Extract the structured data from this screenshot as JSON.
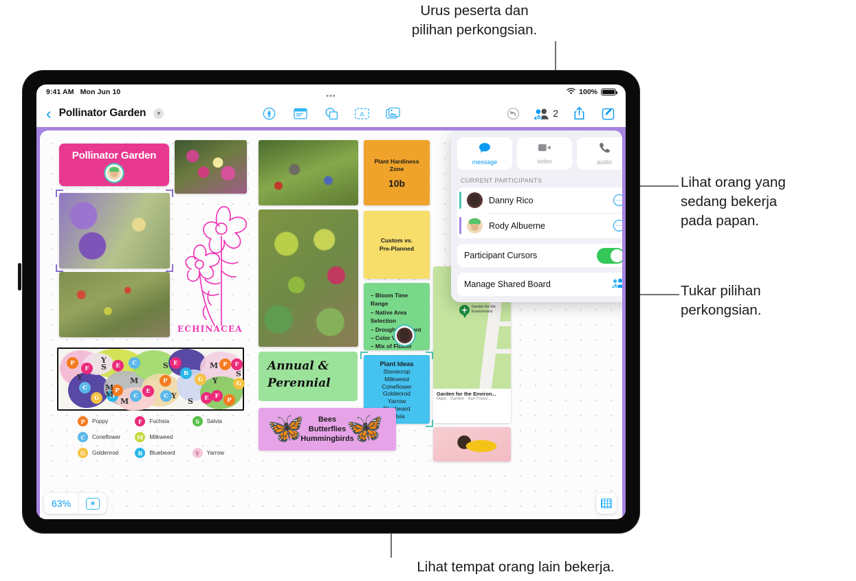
{
  "callouts": {
    "top": "Urus peserta dan\npilihan perkongsian.",
    "right_upper": "Lihat orang yang\nsedang bekerja\npada papan.",
    "right_lower": "Tukar pilihan\nperkongsian.",
    "bottom": "Lihat tempat orang lain bekerja."
  },
  "status_bar": {
    "time": "9:41 AM",
    "date": "Mon Jun 10",
    "wifi_icon": "wifi-icon",
    "battery_percent": "100%",
    "battery_icon": "battery-icon"
  },
  "toolbar": {
    "back_icon": "chevron-left-icon",
    "title": "Pollinator Garden",
    "title_chevron_icon": "chevron-down-icon",
    "overflow_icon": "ellipsis-icon",
    "center_tools": [
      {
        "name": "pen-tool-icon",
        "label": "Pen"
      },
      {
        "name": "sticky-note-icon",
        "label": "Sticky Note"
      },
      {
        "name": "shapes-icon",
        "label": "Shapes"
      },
      {
        "name": "text-box-icon",
        "label": "Text Box"
      },
      {
        "name": "media-icon",
        "label": "Media"
      }
    ],
    "right_tools": [
      {
        "name": "undo-icon",
        "label": "Undo"
      },
      {
        "name": "participants-icon",
        "label": "Participants",
        "count": "2"
      },
      {
        "name": "share-icon",
        "label": "Share"
      },
      {
        "name": "compose-icon",
        "label": "New Board"
      }
    ]
  },
  "popover": {
    "modes": [
      {
        "label": "message",
        "icon": "message-bubble-icon",
        "active": true
      },
      {
        "label": "video",
        "icon": "video-camera-icon",
        "active": false
      },
      {
        "label": "audio",
        "icon": "phone-handset-icon",
        "active": false
      }
    ],
    "section_header": "CURRENT PARTICIPANTS",
    "participants": [
      {
        "name": "Danny Rico",
        "color": "#4fc5b5",
        "more_icon": "more-circle-icon"
      },
      {
        "name": "Rody Albuerne",
        "color": "#a583e0",
        "more_icon": "more-circle-icon"
      }
    ],
    "participant_cursors": {
      "label": "Participant Cursors",
      "enabled": true
    },
    "manage_shared_board": {
      "label": "Manage Shared Board",
      "icon": "manage-participants-icon"
    }
  },
  "board": {
    "title_card": {
      "text": "Pollinator Garden",
      "color": "#e8388f"
    },
    "photos": [
      {
        "name": "butterfly-on-coneflower-photo"
      },
      {
        "name": "bee-on-lavender-photo"
      },
      {
        "name": "hummingbird-photo"
      },
      {
        "name": "garden-bed-photo"
      },
      {
        "name": "succulent-wall-photo"
      },
      {
        "name": "bumblebee-photo"
      }
    ],
    "drawing_label": "ECHINACEA",
    "hand_note": "Annual &\nPerennial",
    "sticky_notes": [
      {
        "name": "plant-hardiness-note",
        "color": "#f0a32a",
        "title": "Plant Hardiness\nZone",
        "big": "10b"
      },
      {
        "name": "custom-vs-preplanned-note",
        "color": "#f7dd6a",
        "title": "Custom vs.\nPre-Planned",
        "big": ""
      },
      {
        "name": "criteria-note",
        "color": "#79d98a",
        "items": [
          "Bloom Time Range",
          "Native Area Selection",
          "Drought Tolerant",
          "Color Variety",
          "Mix of Flower Struc..."
        ]
      },
      {
        "name": "plant-ideas-note",
        "color": "#44c2f0",
        "title": "Plant Ideas",
        "items": [
          "Stonecrop",
          "Milkweed",
          "Coneflower",
          "Goldenrod",
          "Yarrow",
          "Bluebeard",
          "Salvia"
        ]
      }
    ],
    "map_card": {
      "pin_label": "Garden for the\nEnvironment",
      "title": "Garden for the Environ...",
      "subtitle": "Maps · Garden · San Franci..."
    },
    "bees_card": {
      "lines": "Bees\nButterflies\nHummingbirds"
    },
    "plan_legend": [
      {
        "key": "P",
        "label": "Poppy",
        "color": "#f47b20"
      },
      {
        "key": "F",
        "label": "Fuchsia",
        "color": "#ec2a7b"
      },
      {
        "key": "S",
        "label": "Salvia",
        "color": "#58c04a"
      },
      {
        "key": "C",
        "label": "Coneflower",
        "color": "#5bb7ea"
      },
      {
        "key": "M",
        "label": "Milkweed",
        "color": "#c3d93b"
      },
      {
        "key": "G",
        "label": "Goldenrod",
        "color": "#f5c242"
      },
      {
        "key": "B",
        "label": "Bluebeard",
        "color": "#29b7e8"
      },
      {
        "key": "Y",
        "label": "Yarrow",
        "color": "#f5c6da"
      }
    ],
    "zoom_level": "63%",
    "favorite_icon": "star-icon",
    "grid_icon": "grid-icon"
  }
}
